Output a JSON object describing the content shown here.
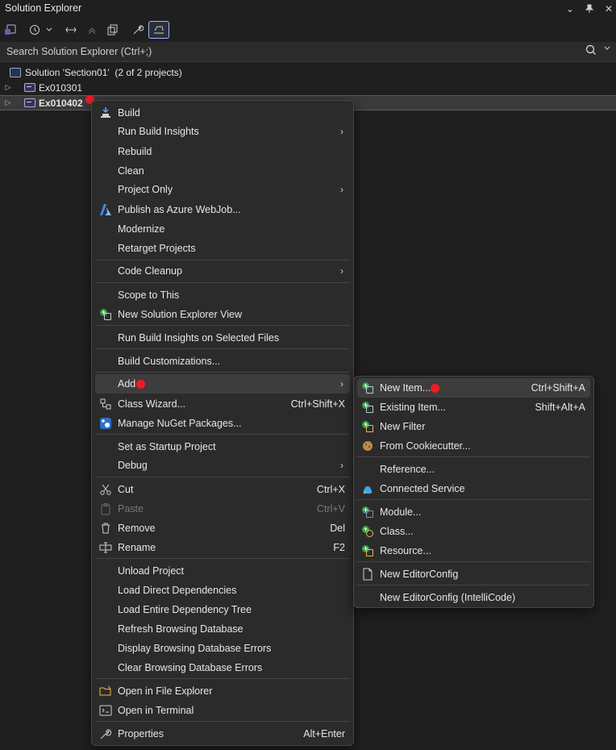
{
  "window": {
    "title": "Solution Explorer",
    "buttons": {
      "dropdown": "⌄",
      "pin": "📌",
      "close": "✕"
    }
  },
  "search": {
    "placeholder": "Search Solution Explorer (Ctrl+;)"
  },
  "tree": {
    "solution_label": "Solution 'Section01'  (2 of 2 projects)",
    "projects": [
      {
        "name": "Ex010301",
        "selected": false
      },
      {
        "name": "Ex010402",
        "selected": true
      }
    ]
  },
  "context_menu": {
    "items": [
      {
        "label": "Build",
        "icon": "build-icon"
      },
      {
        "label": "Run Build Insights",
        "submenu": true
      },
      {
        "label": "Rebuild"
      },
      {
        "label": "Clean"
      },
      {
        "label": "Project Only",
        "submenu": true
      },
      {
        "label": "Publish as Azure WebJob...",
        "icon": "azure-icon"
      },
      {
        "label": "Modernize"
      },
      {
        "label": "Retarget Projects"
      },
      {
        "label": "Code Cleanup",
        "submenu": true
      },
      {
        "label": "Scope to This"
      },
      {
        "label": "New Solution Explorer View",
        "icon": "new-view-icon"
      },
      {
        "label": "Run Build Insights on Selected Files"
      },
      {
        "label": "Build Customizations..."
      },
      {
        "label": "Add",
        "submenu": true,
        "highlighted": true
      },
      {
        "label": "Class Wizard...",
        "shortcut": "Ctrl+Shift+X",
        "icon": "class-wizard-icon"
      },
      {
        "label": "Manage NuGet Packages...",
        "icon": "nuget-icon"
      },
      {
        "label": "Set as Startup Project"
      },
      {
        "label": "Debug",
        "submenu": true
      },
      {
        "label": "Cut",
        "shortcut": "Ctrl+X",
        "icon": "scissors-icon"
      },
      {
        "label": "Paste",
        "shortcut": "Ctrl+V",
        "icon": "paste-icon",
        "disabled": true
      },
      {
        "label": "Remove",
        "shortcut": "Del",
        "icon": "trash-icon"
      },
      {
        "label": "Rename",
        "shortcut": "F2",
        "icon": "rename-icon"
      },
      {
        "label": "Unload Project"
      },
      {
        "label": "Load Direct Dependencies"
      },
      {
        "label": "Load Entire Dependency Tree"
      },
      {
        "label": "Refresh Browsing Database"
      },
      {
        "label": "Display Browsing Database Errors"
      },
      {
        "label": "Clear Browsing Database Errors"
      },
      {
        "label": "Open in File Explorer",
        "icon": "folder-icon"
      },
      {
        "label": "Open in Terminal",
        "icon": "terminal-icon"
      },
      {
        "label": "Properties",
        "shortcut": "Alt+Enter",
        "icon": "wrench-icon"
      }
    ]
  },
  "add_submenu": {
    "items": [
      {
        "label": "New Item...",
        "shortcut": "Ctrl+Shift+A",
        "icon": "new-item-icon",
        "highlighted": true
      },
      {
        "label": "Existing Item...",
        "shortcut": "Shift+Alt+A",
        "icon": "existing-item-icon"
      },
      {
        "label": "New Filter",
        "icon": "new-filter-icon"
      },
      {
        "label": "From Cookiecutter...",
        "icon": "cookiecutter-icon"
      },
      {
        "label": "Reference..."
      },
      {
        "label": "Connected Service",
        "icon": "connected-service-icon"
      },
      {
        "label": "Module...",
        "icon": "module-icon"
      },
      {
        "label": "Class...",
        "icon": "class-icon"
      },
      {
        "label": "Resource...",
        "icon": "resource-icon"
      },
      {
        "label": "New EditorConfig",
        "icon": "document-icon"
      },
      {
        "label": "New EditorConfig (IntelliCode)"
      }
    ]
  },
  "colors": {
    "background": "#1f1f1f",
    "menu": "#2b2b2b",
    "marker": "#ee1c25"
  }
}
